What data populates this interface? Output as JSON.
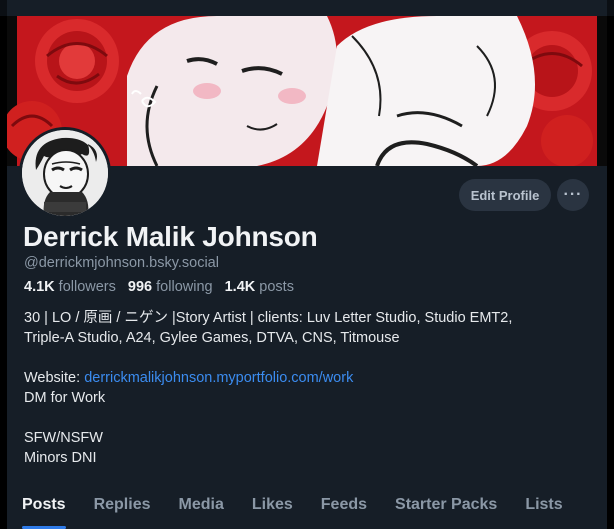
{
  "profile": {
    "display_name": "Derrick Malik Johnson",
    "handle": "@derrickmjohnson.bsky.social",
    "edit_label": "Edit Profile",
    "more_label": "···"
  },
  "stats": {
    "followers_count": "4.1K",
    "followers_label": "followers",
    "following_count": "996",
    "following_label": "following",
    "posts_count": "1.4K",
    "posts_label": "posts"
  },
  "bio": {
    "line1": "30 | LO / 原画 / ニゲン |Story Artist | clients: Luv Letter Studio, Studio EMT2,",
    "line2": "Triple-A Studio, A24, Gylee Games, DTVA, CNS, Titmouse",
    "website_label": "Website: ",
    "website_link": "derrickmalikjohnson.myportfolio.com/work",
    "line4": "DM for Work",
    "line5": "SFW/NSFW",
    "line6": "Minors DNI"
  },
  "tabs": [
    "Posts",
    "Replies",
    "Media",
    "Likes",
    "Feeds",
    "Starter Packs",
    "Lists"
  ],
  "colors": {
    "background": "#161e27",
    "link": "#3b8cf0",
    "tab_indicator": "#2f7be8",
    "button_bg": "#2a3441"
  },
  "icons": {
    "more": "ellipsis-icon",
    "banner": "banner-illustration",
    "avatar": "avatar-illustration"
  }
}
